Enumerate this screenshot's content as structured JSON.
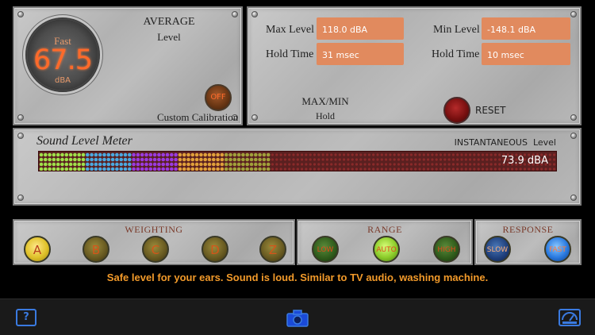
{
  "average": {
    "mode": "Fast",
    "value": "67.5",
    "unit": "dBA",
    "title": "AVERAGE",
    "subtitle": "Level",
    "calibration_button": "OFF",
    "calibration_label": "Custom Calibration"
  },
  "maxmin": {
    "max_level_label": "Max Level",
    "max_level_value": "118.0 dBA",
    "min_level_label": "Min Level",
    "min_level_value": "-148.1 dBA",
    "hold_time_label_1": "Hold Time",
    "hold_time_value_1": "31 msec",
    "hold_time_label_2": "Hold Time",
    "hold_time_value_2": "10 msec",
    "title": "MAX/MIN",
    "subtitle": "Hold",
    "reset_label": "RESET"
  },
  "meter": {
    "title": "Sound Level Meter",
    "instantaneous_title": "INSTANTANEOUS",
    "instantaneous_sub": "Level",
    "reading": "73.9 dBA",
    "level_fraction": 0.45,
    "segment_colors": [
      "#9fe04a",
      "#4aa8e0",
      "#9a3ae0",
      "#e0a03a",
      "#a0a03a"
    ]
  },
  "weighting": {
    "title": "WEIGHTING",
    "buttons": [
      "A",
      "B",
      "C",
      "D",
      "Z"
    ],
    "selected": "A"
  },
  "range": {
    "title": "RANGE",
    "buttons": [
      "LOW",
      "AUTO",
      "HIGH"
    ],
    "selected": "AUTO"
  },
  "response": {
    "title": "RESPONSE",
    "buttons": [
      "SLOW",
      "FAST"
    ],
    "selected": "FAST"
  },
  "advice": "Safe level for your ears. Sound is loud. Similar to TV audio, washing machine.",
  "toolbar": {
    "help_label": "?",
    "accent": "#3a7ae0"
  }
}
